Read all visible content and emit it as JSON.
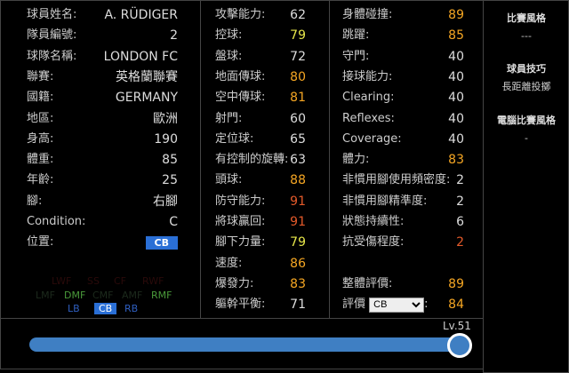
{
  "info": [
    {
      "label": "球員姓名:",
      "value": "A. RÜDIGER"
    },
    {
      "label": "隊員編號:",
      "value": "2"
    },
    {
      "label": "球隊名稱:",
      "value": "LONDON FC"
    },
    {
      "label": "聯賽:",
      "value": "英格蘭聯賽"
    },
    {
      "label": "國籍:",
      "value": "GERMANY"
    },
    {
      "label": "地區:",
      "value": "歐洲"
    },
    {
      "label": "身高:",
      "value": "190"
    },
    {
      "label": "體重:",
      "value": "85"
    },
    {
      "label": "年齡:",
      "value": "25"
    },
    {
      "label": "腳:",
      "value": "右腳"
    },
    {
      "label": "Condition:",
      "value": "C"
    },
    {
      "label": "位置:",
      "value": "CB"
    }
  ],
  "positions": {
    "top": [
      "LWF",
      "SS",
      "CF",
      "RWF"
    ],
    "mid": [
      "LMF",
      "DMF",
      "CMF",
      "AMF",
      "RMF"
    ],
    "low": [
      "LB",
      "CB",
      "RB"
    ]
  },
  "stats1": [
    {
      "label": "攻擊能力:",
      "value": "62",
      "c": "w"
    },
    {
      "label": "控球:",
      "value": "79",
      "c": "y"
    },
    {
      "label": "盤球:",
      "value": "72",
      "c": "w"
    },
    {
      "label": "地面傳球:",
      "value": "80",
      "c": "o"
    },
    {
      "label": "空中傳球:",
      "value": "81",
      "c": "o"
    },
    {
      "label": "射門:",
      "value": "60",
      "c": "w"
    },
    {
      "label": "定位球:",
      "value": "65",
      "c": "w"
    },
    {
      "label": "有控制的旋轉:",
      "value": "63",
      "c": "w"
    },
    {
      "label": "頭球:",
      "value": "88",
      "c": "o"
    },
    {
      "label": "防守能力:",
      "value": "91",
      "c": "r"
    },
    {
      "label": "將球贏回:",
      "value": "91",
      "c": "r"
    },
    {
      "label": "腳下力量:",
      "value": "79",
      "c": "y"
    },
    {
      "label": "速度:",
      "value": "86",
      "c": "o"
    },
    {
      "label": "爆發力:",
      "value": "83",
      "c": "o"
    },
    {
      "label": "軀幹平衡:",
      "value": "71",
      "c": "w"
    }
  ],
  "stats2": [
    {
      "label": "身體碰撞:",
      "value": "89",
      "c": "o"
    },
    {
      "label": "跳躍:",
      "value": "85",
      "c": "o"
    },
    {
      "label": "守門:",
      "value": "40",
      "c": "w"
    },
    {
      "label": "接球能力:",
      "value": "40",
      "c": "w"
    },
    {
      "label": "Clearing:",
      "value": "40",
      "c": "w"
    },
    {
      "label": "Reflexes:",
      "value": "40",
      "c": "w"
    },
    {
      "label": "Coverage:",
      "value": "40",
      "c": "w"
    },
    {
      "label": "體力:",
      "value": "83",
      "c": "o"
    },
    {
      "label": "非慣用腳使用頻密度:",
      "value": "2",
      "c": "w"
    },
    {
      "label": "非慣用腳精準度:",
      "value": "2",
      "c": "w"
    },
    {
      "label": "狀態持續性:",
      "value": "6",
      "c": "w"
    },
    {
      "label": "抗受傷程度:",
      "value": "2",
      "c": "r"
    }
  ],
  "overall": {
    "label": "整體評價:",
    "value": "89"
  },
  "rating": {
    "label": "評價",
    "select": "CB",
    "suffix": ":",
    "value": "84"
  },
  "side": {
    "style_h": "比賽風格",
    "style_v": "---",
    "skills_h": "球員技巧",
    "skills_v": "長距離投擲",
    "ai_h": "電腦比賽風格",
    "ai_v": "-"
  },
  "level": {
    "label": "Lv.51",
    "fraction": 1.0
  }
}
